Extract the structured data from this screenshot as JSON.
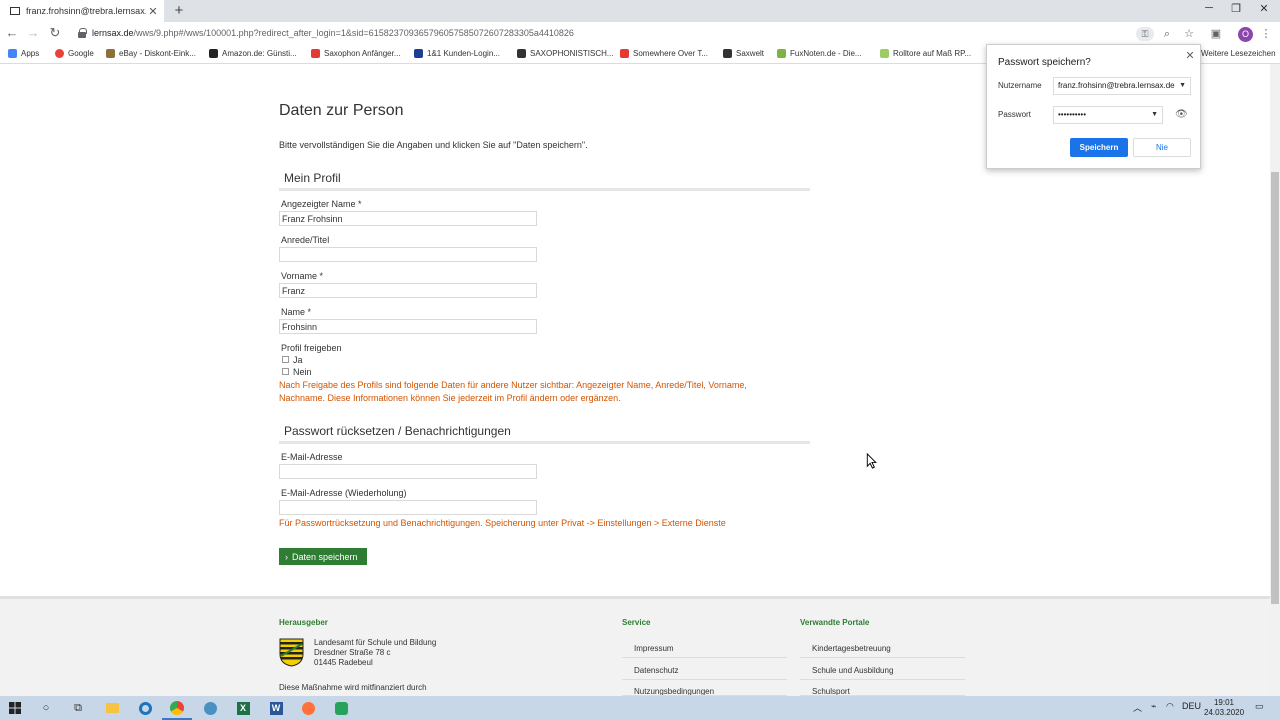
{
  "browser": {
    "tab_title": "franz.frohsinn@trebra.lernsax.de",
    "new_tab": "+",
    "url_host": "lernsax.de",
    "url_path": "/wws/9.php#/wws/100001.php?redirect_after_login=1&sid=61582370936579605758507260728330​5a4410826",
    "bookmarks": [
      {
        "label": "Apps",
        "color": "#4285f4"
      },
      {
        "label": "Google",
        "color": "#ea4335"
      },
      {
        "label": "eBay - Diskont-Eink...",
        "color": "#8e6e3a"
      },
      {
        "label": "Amazon.de: Günsti...",
        "color": "#222222"
      },
      {
        "label": "Saxophon Anfänger...",
        "color": "#e53935"
      },
      {
        "label": "1&1 Kunden-Login...",
        "color": "#1c3f94"
      },
      {
        "label": "SAXOPHONISTISCH...",
        "color": "#333333"
      },
      {
        "label": "Somewhere Over T...",
        "color": "#e53935"
      },
      {
        "label": "Saxwelt",
        "color": "#333333"
      },
      {
        "label": "FuxNoten.de - Die...",
        "color": "#7cb342"
      },
      {
        "label": "Rolltore auf Maß RP...",
        "color": "#9ccc65"
      },
      {
        "label": "Weitere Lesezeichen",
        "color": "#f5b800"
      }
    ],
    "profile_initial": "O"
  },
  "page": {
    "title": "Daten zur Person",
    "intro": "Bitte vervollständigen Sie die Angaben und klicken Sie auf \"Daten speichern\".",
    "profile_section": "Mein Profil",
    "fields": {
      "display_name_label": "Angezeigter Name *",
      "display_name_value": "Franz Frohsinn",
      "salutation_label": "Anrede/Titel",
      "salutation_value": "",
      "firstname_label": "Vorname *",
      "firstname_value": "Franz",
      "lastname_label": "Name *",
      "lastname_value": "Frohsinn"
    },
    "share_profile_label": "Profil freigeben",
    "share_yes": "Ja",
    "share_no": "Nein",
    "share_note_line1": "Nach Freigabe des Profils sind folgende Daten für andere Nutzer sichtbar: Angezeigter Name, Anrede/Titel, Vorname,",
    "share_note_line2": "Nachname. Diese Informationen können Sie jederzeit im Profil ändern oder ergänzen.",
    "password_section": "Passwort rücksetzen / Benachrichtigungen",
    "email_label": "E-Mail-Adresse",
    "email_value": "",
    "email_repeat_label": "E-Mail-Adresse (Wiederholung)",
    "email_repeat_value": "",
    "email_note": "Für Passwortrücksetzung und Benachrichtigungen. Speicherung unter Privat -> Einstellungen > Externe Dienste",
    "save_button": "Daten speichern"
  },
  "footer": {
    "publisher_heading": "Herausgeber",
    "publisher_line1": "Landesamt für Schule und Bildung",
    "publisher_line2": "Dresdner Straße 78 c",
    "publisher_line3": "01445 Radebeul",
    "funding": "Diese Maßnahme wird mitfinanziert durch",
    "service_heading": "Service",
    "service_links": [
      "Impressum",
      "Datenschutz",
      "Nutzungsbedingungen"
    ],
    "portals_heading": "Verwandte Portale",
    "portal_links": [
      "Kindertagesbetreuung",
      "Schule und Ausbildung",
      "Schulsport"
    ]
  },
  "password_popup": {
    "title": "Passwort speichern?",
    "username_label": "Nutzername",
    "username_value": "franz.frohsinn@trebra.lernsax.de",
    "password_label": "Passwort",
    "password_value": "••••••••••",
    "save_button": "Speichern",
    "never_button": "Nie"
  },
  "taskbar": {
    "language": "DEU",
    "time": "19:01",
    "date": "24.03.2020"
  },
  "colors": {
    "accent_green": "#2e7d32",
    "note_orange": "#d35400",
    "chrome_blue": "#1a73e8"
  }
}
